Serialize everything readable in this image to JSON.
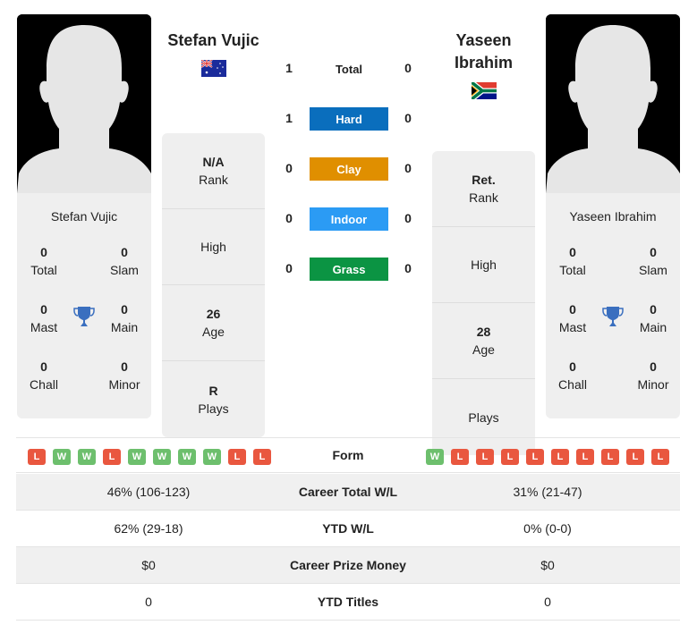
{
  "player1": {
    "name": "Stefan Vujic",
    "card_name": "Stefan Vujic",
    "flag": "australia-flag",
    "rank": {
      "value": "N/A",
      "label": "Rank"
    },
    "high": {
      "value": "",
      "label": "High"
    },
    "age": {
      "value": "26",
      "label": "Age"
    },
    "plays": {
      "value": "R",
      "label": "Plays"
    },
    "titles": {
      "total": {
        "value": "0",
        "label": "Total"
      },
      "slam": {
        "value": "0",
        "label": "Slam"
      },
      "mast": {
        "value": "0",
        "label": "Mast"
      },
      "main": {
        "value": "0",
        "label": "Main"
      },
      "chall": {
        "value": "0",
        "label": "Chall"
      },
      "minor": {
        "value": "0",
        "label": "Minor"
      }
    },
    "form": [
      "L",
      "W",
      "W",
      "L",
      "W",
      "W",
      "W",
      "W",
      "L",
      "L"
    ]
  },
  "player2": {
    "name_line1": "Yaseen",
    "name_line2": "Ibrahim",
    "card_name": "Yaseen Ibrahim",
    "flag": "south-africa-flag",
    "rank": {
      "value": "Ret.",
      "label": "Rank"
    },
    "high": {
      "value": "",
      "label": "High"
    },
    "age": {
      "value": "28",
      "label": "Age"
    },
    "plays": {
      "value": "",
      "label": "Plays"
    },
    "titles": {
      "total": {
        "value": "0",
        "label": "Total"
      },
      "slam": {
        "value": "0",
        "label": "Slam"
      },
      "mast": {
        "value": "0",
        "label": "Mast"
      },
      "main": {
        "value": "0",
        "label": "Main"
      },
      "chall": {
        "value": "0",
        "label": "Chall"
      },
      "minor": {
        "value": "0",
        "label": "Minor"
      }
    },
    "form": [
      "W",
      "L",
      "L",
      "L",
      "L",
      "L",
      "L",
      "L",
      "L",
      "L"
    ]
  },
  "h2h": [
    {
      "label": "Total",
      "p1": "1",
      "p2": "0",
      "color": ""
    },
    {
      "label": "Hard",
      "p1": "1",
      "p2": "0",
      "color": "#0a6ebd"
    },
    {
      "label": "Clay",
      "p1": "0",
      "p2": "0",
      "color": "#e08f00"
    },
    {
      "label": "Indoor",
      "p1": "0",
      "p2": "0",
      "color": "#2b9bf4"
    },
    {
      "label": "Grass",
      "p1": "0",
      "p2": "0",
      "color": "#0b9443"
    }
  ],
  "form_label": "Form",
  "stats": [
    {
      "label": "Career Total W/L",
      "p1": "46% (106-123)",
      "p2": "31% (21-47)"
    },
    {
      "label": "YTD W/L",
      "p1": "62% (29-18)",
      "p2": "0% (0-0)"
    },
    {
      "label": "Career Prize Money",
      "p1": "$0",
      "p2": "$0"
    },
    {
      "label": "YTD Titles",
      "p1": "0",
      "p2": "0"
    }
  ]
}
